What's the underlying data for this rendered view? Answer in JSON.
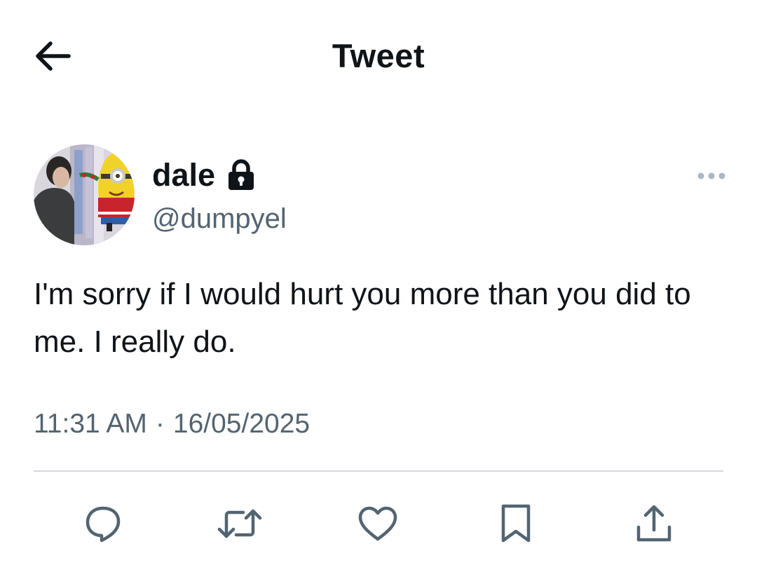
{
  "header": {
    "title": "Tweet"
  },
  "author": {
    "display_name": "dale",
    "handle": "@dumpyel",
    "protected": true
  },
  "tweet": {
    "text": "I'm sorry if I would hurt you more than you did to me. I really do.",
    "time": "11:31 AM",
    "separator": "·",
    "date": "16/05/2025"
  },
  "icons": {
    "back": "arrow-left-icon",
    "lock": "lock-icon",
    "more": "more-horizontal-icon",
    "reply": "reply-icon",
    "retweet": "retweet-icon",
    "like": "heart-icon",
    "bookmark": "bookmark-icon",
    "share": "share-icon"
  },
  "colors": {
    "text_primary": "#0f1419",
    "text_secondary": "#536471",
    "divider": "#cfd9de",
    "icon": "#536471"
  }
}
